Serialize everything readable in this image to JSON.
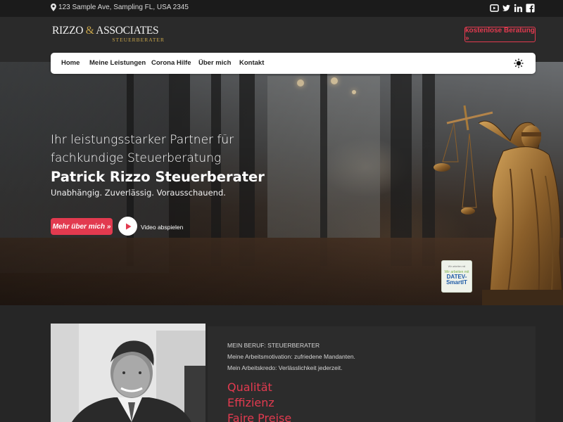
{
  "topbar": {
    "address": "123 Sample Ave, Sampling FL, USA 2345",
    "socials": [
      "youtube-icon",
      "twitter-icon",
      "linkedin-icon",
      "facebook-icon"
    ]
  },
  "logo": {
    "main_a": "RIZZO ",
    "amp": "&",
    "main_b": " ASSOCIATES",
    "sub": "STEUERBERATER"
  },
  "header": {
    "cta": "kostenlose Beratung »"
  },
  "nav": {
    "items": [
      "Home",
      "Meine Leistungen",
      "Corona Hilfe",
      "Über mich",
      "Kontakt"
    ],
    "theme_icon": "sun-icon"
  },
  "hero": {
    "line1": "Ihr leistungsstarker Partner für",
    "line2": "fachkundige Steuerberatung",
    "name": "Patrick Rizzo Steuerberater",
    "tagline": "Unabhängig. Zuverlässig. Vorausschauend.",
    "button": "Mehr über mich »",
    "video_label": "Video abspielen"
  },
  "badge": {
    "line1": "DATEV",
    "small1": "Wir arbeiten mit",
    "small2": "Wir arbeiten mit",
    "title": "DATEV-SmartIT"
  },
  "about": {
    "kicker": "MEIN BERUF: STEUERBERATER",
    "line1": "Meine Arbeitsmotivation: zufriedene Mandanten.",
    "line2": "Mein Arbeitskredo: Verlässlichkeit jederzeit.",
    "values": [
      "Qualität",
      "Effizienz",
      "Faire Preise"
    ]
  },
  "colors": {
    "accent": "#e23a4f",
    "gold": "#c7a44a",
    "bg": "#262626"
  }
}
